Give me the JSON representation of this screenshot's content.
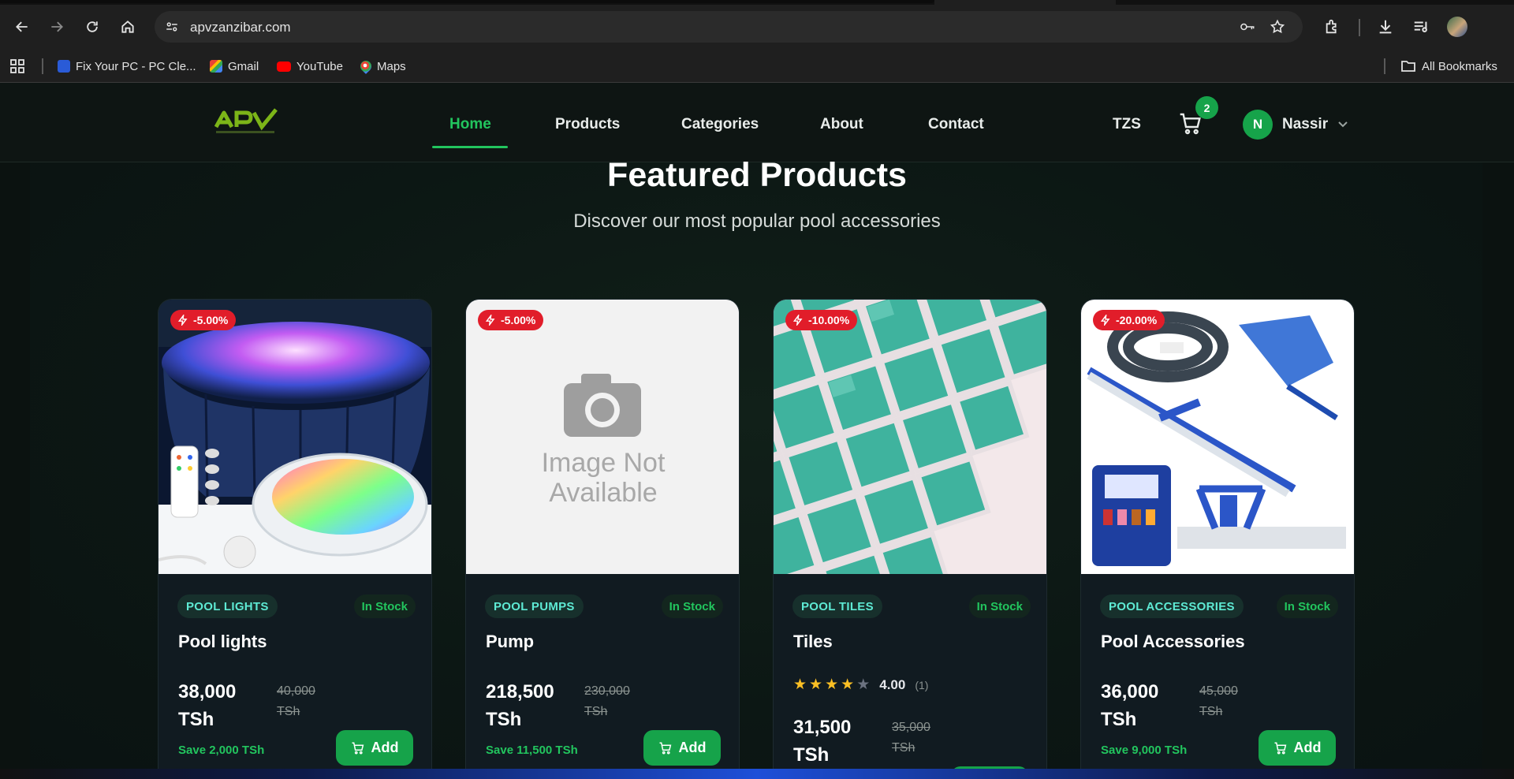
{
  "browser": {
    "url": "apvzanzibar.com",
    "bookmarks": [
      {
        "label": "Fix Your PC - PC Cle...",
        "icon": "shield-icon"
      },
      {
        "label": "Gmail",
        "icon": "gmail-icon"
      },
      {
        "label": "YouTube",
        "icon": "youtube-icon"
      },
      {
        "label": "Maps",
        "icon": "maps-icon"
      }
    ],
    "all_bookmarks_label": "All Bookmarks"
  },
  "site": {
    "nav": {
      "home": "Home",
      "products": "Products",
      "categories": "Categories",
      "about": "About",
      "contact": "Contact"
    },
    "currency": "TZS",
    "cart_count": "2",
    "user": {
      "initial": "N",
      "name": "Nassir"
    },
    "section": {
      "title": "Featured Products",
      "subtitle": "Discover our most popular pool accessories"
    },
    "products": [
      {
        "discount": "-5.00%",
        "category": "POOL LIGHTS",
        "stock": "In Stock",
        "name": "Pool lights",
        "price_amount": "38,000",
        "price_unit": "TSh",
        "old_amount": "40,000",
        "old_unit": "TSh",
        "save": "Save 2,000 TSh",
        "add": "Add"
      },
      {
        "discount": "-5.00%",
        "category": "POOL PUMPS",
        "stock": "In Stock",
        "name": "Pump",
        "price_amount": "218,500",
        "price_unit": "TSh",
        "old_amount": "230,000",
        "old_unit": "TSh",
        "save": "Save 11,500 TSh",
        "add": "Add",
        "image_text_1": "Image Not",
        "image_text_2": "Available"
      },
      {
        "discount": "-10.00%",
        "category": "POOL TILES",
        "stock": "In Stock",
        "name": "Tiles",
        "rating": "4.00",
        "rating_count": "(1)",
        "rating_stars": 4,
        "price_amount": "31,500",
        "price_unit": "TSh",
        "old_amount": "35,000",
        "old_unit": "TSh"
      },
      {
        "discount": "-20.00%",
        "category": "POOL ACCESSORIES",
        "stock": "In Stock",
        "name": "Pool Accessories",
        "price_amount": "36,000",
        "price_unit": "TSh",
        "old_amount": "45,000",
        "old_unit": "TSh",
        "save": "Save 9,000 TSh",
        "add": "Add"
      }
    ],
    "colors": {
      "accent": "#22c55e",
      "badge": "#e11d2a",
      "card_bg": "#111b21"
    }
  }
}
